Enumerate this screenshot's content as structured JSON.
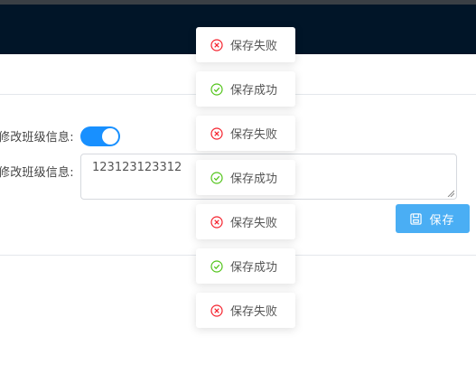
{
  "form": {
    "switch_label": "修改班级信息:",
    "text_label": "修改班级信息:",
    "textarea_value": "123123123312",
    "switch_on": true,
    "save_label": "保存"
  },
  "toasts": [
    {
      "type": "error",
      "text": "保存失败"
    },
    {
      "type": "success",
      "text": "保存成功"
    },
    {
      "type": "error",
      "text": "保存失败"
    },
    {
      "type": "success",
      "text": "保存成功"
    },
    {
      "type": "error",
      "text": "保存失败"
    },
    {
      "type": "success",
      "text": "保存成功"
    },
    {
      "type": "error",
      "text": "保存失败"
    }
  ],
  "colors": {
    "header": "#011528",
    "accent": "#1890ff",
    "button": "#4aaef4",
    "error": "#f5222d",
    "success": "#52c41a"
  }
}
